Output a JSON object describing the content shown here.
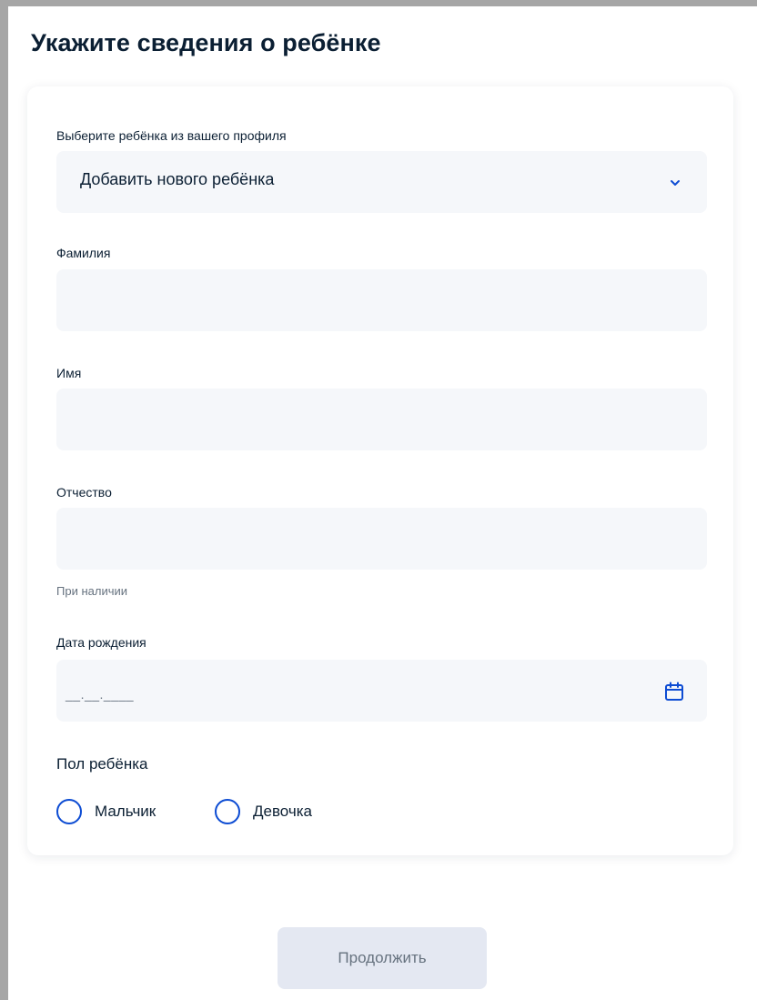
{
  "page": {
    "title": "Укажите сведения о ребёнке"
  },
  "form": {
    "child_select": {
      "label": "Выберите ребёнка из вашего профиля",
      "value": "Добавить нового ребёнка",
      "icon": "chevron-down-icon"
    },
    "surname": {
      "label": "Фамилия",
      "value": ""
    },
    "name": {
      "label": "Имя",
      "value": ""
    },
    "patronymic": {
      "label": "Отчество",
      "value": "",
      "hint": "При наличии"
    },
    "birth_date": {
      "label": "Дата рождения",
      "value": "__.__.____",
      "icon": "calendar-icon"
    },
    "gender": {
      "label": "Пол ребёнка",
      "options": [
        "Мальчик",
        "Девочка"
      ]
    }
  },
  "actions": {
    "continue_label": "Продолжить"
  },
  "colors": {
    "accent": "#0d4cd3",
    "text": "#0b1f33",
    "muted": "#66727f",
    "field_bg": "#f5f7fa",
    "disabled_button_bg": "#e4e8f2"
  }
}
